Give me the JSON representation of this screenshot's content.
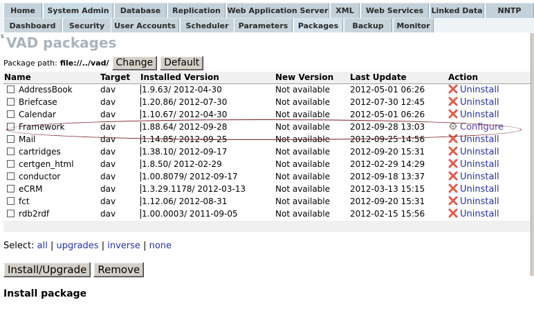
{
  "tabs_primary": [
    {
      "label": "Home",
      "active": false
    },
    {
      "label": "System Admin",
      "active": true
    },
    {
      "label": "Database",
      "active": false
    },
    {
      "label": "Replication",
      "active": false
    },
    {
      "label": "Web Application Server",
      "active": false
    },
    {
      "label": "XML",
      "active": false
    },
    {
      "label": "Web Services",
      "active": false
    },
    {
      "label": "Linked Data",
      "active": false
    },
    {
      "label": "NNTP",
      "active": false
    }
  ],
  "tabs_secondary": [
    {
      "label": "Dashboard",
      "active": false
    },
    {
      "label": "Security",
      "active": false
    },
    {
      "label": "User Accounts",
      "active": false
    },
    {
      "label": "Scheduler",
      "active": false
    },
    {
      "label": "Parameters",
      "active": false
    },
    {
      "label": "Packages",
      "active": true
    },
    {
      "label": "Backup",
      "active": false
    },
    {
      "label": "Monitor",
      "active": false
    }
  ],
  "page": {
    "prefix": "s",
    "title": "VAD packages"
  },
  "package_path": {
    "label": "Package path:",
    "value": "file://../vad/",
    "change_button": "Change",
    "default_button": "Default"
  },
  "table": {
    "headers": {
      "name": "Name",
      "target": "Target",
      "installed": "Installed Version",
      "new_version": "New Version",
      "last_update": "Last Update",
      "action": "Action"
    },
    "rows": [
      {
        "name": "AddressBook",
        "target": "dav",
        "installed": "1.9.63/ 2012-04-30",
        "new_version": "Not available",
        "last_update": "2012-05-01 06:26",
        "action": "Uninstall",
        "action_type": "uninstall"
      },
      {
        "name": "Briefcase",
        "target": "dav",
        "installed": "1.20.86/ 2012-07-30",
        "new_version": "Not available",
        "last_update": "2012-07-30 12:45",
        "action": "Uninstall",
        "action_type": "uninstall"
      },
      {
        "name": "Calendar",
        "target": "dav",
        "installed": "1.10.67/ 2012-04-30",
        "new_version": "Not available",
        "last_update": "2012-05-01 06:26",
        "action": "Uninstall",
        "action_type": "uninstall"
      },
      {
        "name": "Framework",
        "target": "dav",
        "installed": "1.88.64/ 2012-09-28",
        "new_version": "Not available",
        "last_update": "2012-09-28 13:03",
        "action": "Configure",
        "action_type": "configure"
      },
      {
        "name": "Mail",
        "target": "dav",
        "installed": "1.14.85/ 2012-09-25",
        "new_version": "Not available",
        "last_update": "2012-09-25 14:56",
        "action": "Uninstall",
        "action_type": "uninstall"
      },
      {
        "name": "cartridges",
        "target": "dav",
        "installed": "1.38.10/ 2012-09-17",
        "new_version": "Not available",
        "last_update": "2012-09-20 15:31",
        "action": "Uninstall",
        "action_type": "uninstall"
      },
      {
        "name": "certgen_html",
        "target": "dav",
        "installed": "1.8.50/ 2012-02-29",
        "new_version": "Not available",
        "last_update": "2012-02-29 14:29",
        "action": "Uninstall",
        "action_type": "uninstall"
      },
      {
        "name": "conductor",
        "target": "dav",
        "installed": "1.00.8079/ 2012-09-17",
        "new_version": "Not available",
        "last_update": "2012-09-18 13:37",
        "action": "Uninstall",
        "action_type": "uninstall"
      },
      {
        "name": "eCRM",
        "target": "dav",
        "installed": "1.3.29.1178/ 2012-03-13",
        "new_version": "Not available",
        "last_update": "2012-03-13 15:15",
        "action": "Uninstall",
        "action_type": "uninstall"
      },
      {
        "name": "fct",
        "target": "dav",
        "installed": "1.12.06/ 2012-08-31",
        "new_version": "Not available",
        "last_update": "2012-09-20 15:31",
        "action": "Uninstall",
        "action_type": "uninstall"
      },
      {
        "name": "rdb2rdf",
        "target": "dav",
        "installed": "1.00.0003/ 2011-09-05",
        "new_version": "Not available",
        "last_update": "2012-02-15 15:56",
        "action": "Uninstall",
        "action_type": "uninstall"
      }
    ]
  },
  "select": {
    "label": "Select:",
    "all": "all",
    "upgrades": "upgrades",
    "inverse": "inverse",
    "none": "none",
    "separator": "|"
  },
  "buttons": {
    "install": "Install/Upgrade",
    "remove": "Remove"
  },
  "install_heading": "Install package",
  "colors": {
    "tab_bg": "#c4d1da",
    "link": "#2431a8",
    "uninstall_icon": "#e05a4a",
    "annotation": "#7a1a22"
  }
}
